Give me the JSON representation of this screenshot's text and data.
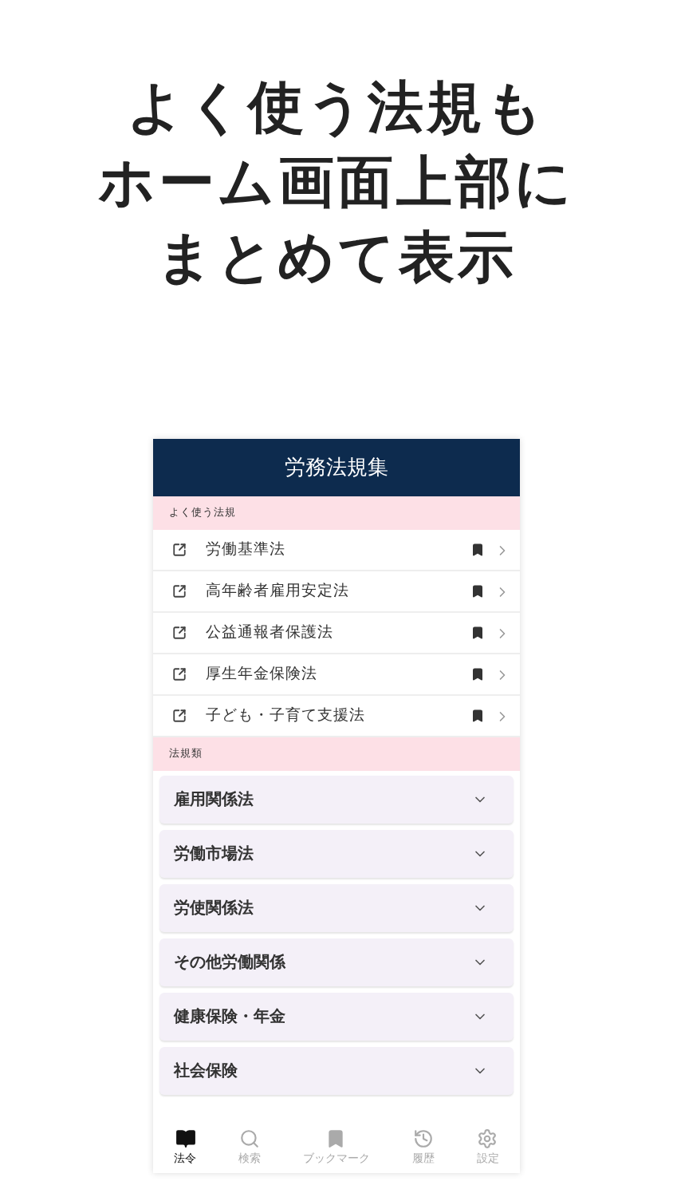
{
  "headline": [
    "よく使う法規も",
    "ホーム画面上部に",
    "まとめて表示"
  ],
  "app": {
    "title": "労務法規集",
    "favorites": {
      "heading": "よく使う法規",
      "items": [
        {
          "label": "労働基準法",
          "bookmarked": true
        },
        {
          "label": "高年齢者雇用安定法",
          "bookmarked": true
        },
        {
          "label": "公益通報者保護法",
          "bookmarked": true
        },
        {
          "label": "厚生年金保険法",
          "bookmarked": true
        },
        {
          "label": "子ども・子育て支援法",
          "bookmarked": true
        }
      ]
    },
    "categories": {
      "heading": "法規類",
      "items": [
        {
          "label": "雇用関係法",
          "expanded": false
        },
        {
          "label": "労働市場法",
          "expanded": false
        },
        {
          "label": "労使関係法",
          "expanded": false
        },
        {
          "label": "その他労働関係",
          "expanded": false
        },
        {
          "label": "健康保険・年金",
          "expanded": false
        },
        {
          "label": "社会保険",
          "expanded": false
        }
      ]
    },
    "tabs": [
      {
        "kind": "laws",
        "label": "法令",
        "selected": true
      },
      {
        "kind": "search",
        "label": "検索",
        "selected": false
      },
      {
        "kind": "bookmark",
        "label": "ブックマーク",
        "selected": false
      },
      {
        "kind": "history",
        "label": "履歴",
        "selected": false
      },
      {
        "kind": "settings",
        "label": "設定",
        "selected": false
      }
    ]
  }
}
